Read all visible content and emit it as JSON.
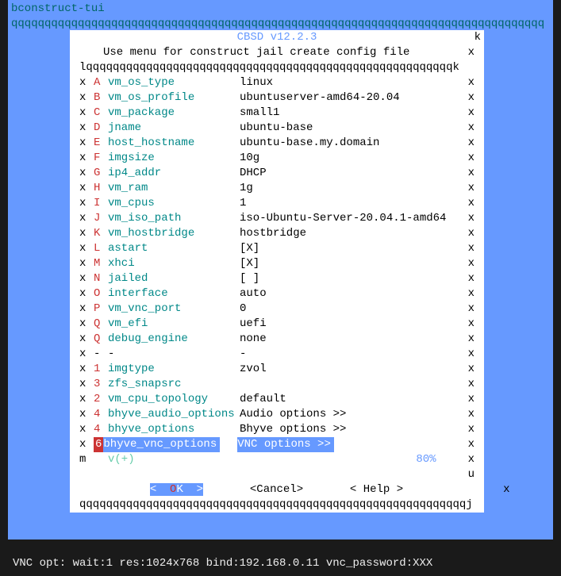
{
  "header": {
    "title": "bconstruct-tui",
    "qline": "qqqqqqqqqqqqqqqqqqqqqqqqqqqqqqqqqqqqqqqqqqqqqqqqqqqqqqqqqqqqqqqqqqqqqqqqqqqqqqqq"
  },
  "dialog": {
    "title": "CBSD v12.2.3",
    "subtitle": "Use menu for construct jail create config file",
    "border": "lqqqqqqqqqqqqqqqqqqqqqqqqqqqqqqqqqqqqqqqqqqqqqqqqqqqqqqqk",
    "bottom": "qqqqqqqqqqqqqqqqqqqqqqqqqqqqqqqqqqqqqqqqqqqqqqqqqqqqqqqqqqj",
    "top_k": "k",
    "scroll": {
      "m": "m",
      "vplus": "v(+)",
      "pct": "80%",
      "x": "x",
      "u": "u"
    },
    "buttons": {
      "ok_left": "<  ",
      "ok_o": "O",
      "ok_k": "K",
      "ok_right": "  >",
      "cancel": "<Cancel>",
      "help": "< Help >",
      "x": "x"
    },
    "rows": [
      {
        "key": "A",
        "label": "vm_os_type",
        "val": "linux"
      },
      {
        "key": "B",
        "label": "vm_os_profile",
        "val": "ubuntuserver-amd64-20.04"
      },
      {
        "key": "C",
        "label": "vm_package",
        "val": "small1"
      },
      {
        "key": "D",
        "label": "jname",
        "val": "ubuntu-base"
      },
      {
        "key": "E",
        "label": "host_hostname",
        "val": "ubuntu-base.my.domain"
      },
      {
        "key": "F",
        "label": "imgsize",
        "val": "10g"
      },
      {
        "key": "G",
        "label": "ip4_addr",
        "val": "DHCP"
      },
      {
        "key": "H",
        "label": "vm_ram",
        "val": "1g"
      },
      {
        "key": "I",
        "label": "vm_cpus",
        "val": "1"
      },
      {
        "key": "J",
        "label": "vm_iso_path",
        "val": "iso-Ubuntu-Server-20.04.1-amd64"
      },
      {
        "key": "K",
        "label": "vm_hostbridge",
        "val": "hostbridge"
      },
      {
        "key": "L",
        "label": "astart",
        "val": "[X]"
      },
      {
        "key": "M",
        "label": "xhci",
        "val": "[X]"
      },
      {
        "key": "N",
        "label": "jailed",
        "val": "[ ]"
      },
      {
        "key": "O",
        "label": "interface",
        "val": "auto"
      },
      {
        "key": "P",
        "label": "vm_vnc_port",
        "val": "0"
      },
      {
        "key": "Q",
        "label": "vm_efi",
        "val": "uefi"
      },
      {
        "key": "Q",
        "label": "debug_engine",
        "val": "none"
      },
      {
        "key": "-",
        "label": "-",
        "val": "-",
        "dash": true
      },
      {
        "key": "1",
        "label": "imgtype",
        "val": "zvol"
      },
      {
        "key": "3",
        "label": "zfs_snapsrc",
        "val": ""
      },
      {
        "key": "2",
        "label": "vm_cpu_topology",
        "val": "default"
      },
      {
        "key": "4",
        "label": "bhyve_audio_options",
        "val": "Audio options >>"
      },
      {
        "key": "4",
        "label": "bhyve_options",
        "val": "Bhyve options >>"
      },
      {
        "key": "6",
        "label": "bhyve_vnc_options",
        "val": "VNC options >>",
        "selected": true
      }
    ]
  },
  "statusbar": {
    "text": "VNC opt: wait:1 res:1024x768 bind:192.168.0.11 vnc_password:XXX"
  }
}
